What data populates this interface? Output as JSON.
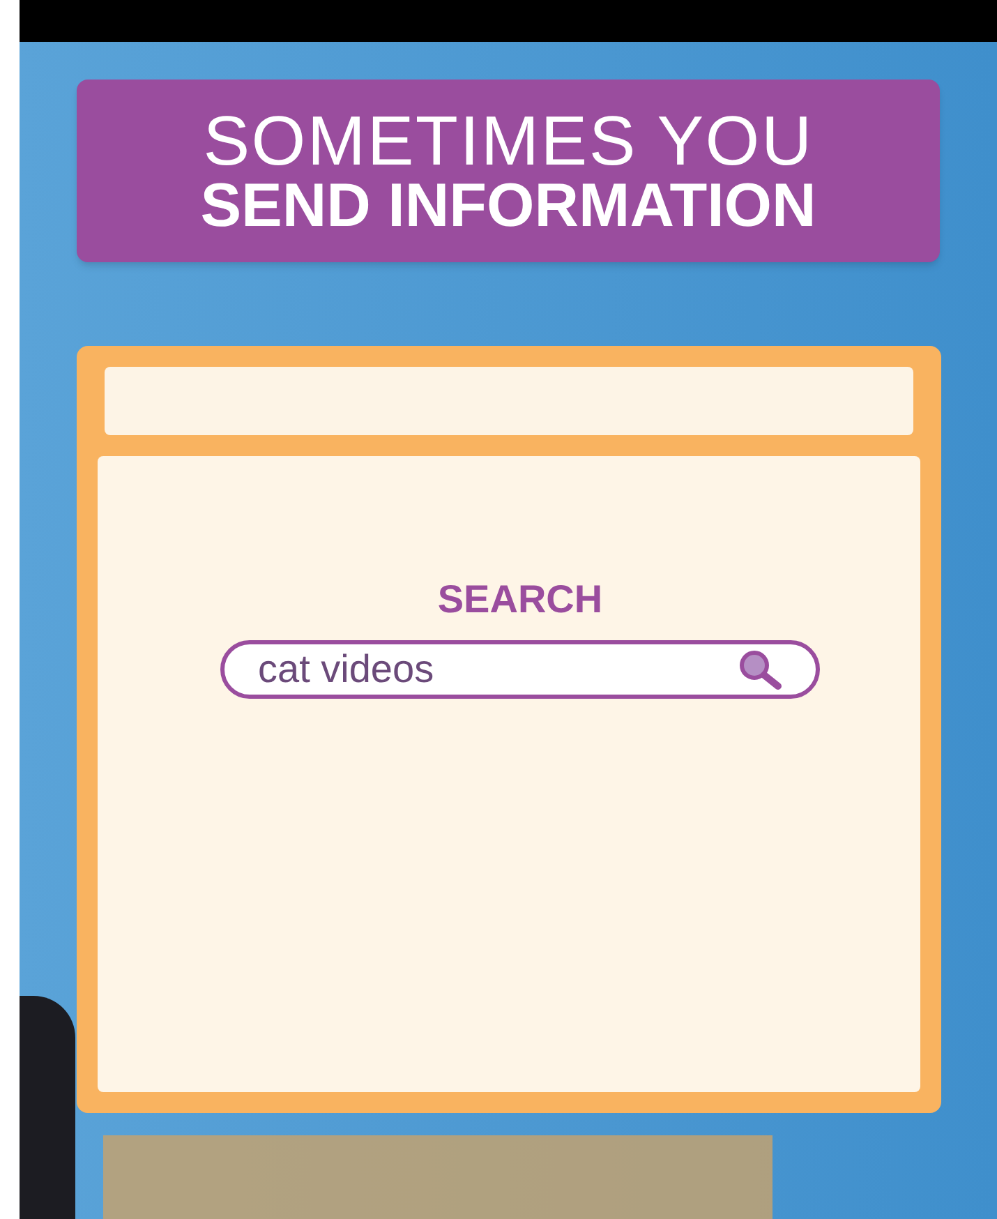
{
  "banner": {
    "lines": [
      "SOMETIMES YOU",
      "SEND INFORMATION"
    ]
  },
  "browser": {
    "search": {
      "label": "SEARCH",
      "value": "cat videos"
    }
  }
}
